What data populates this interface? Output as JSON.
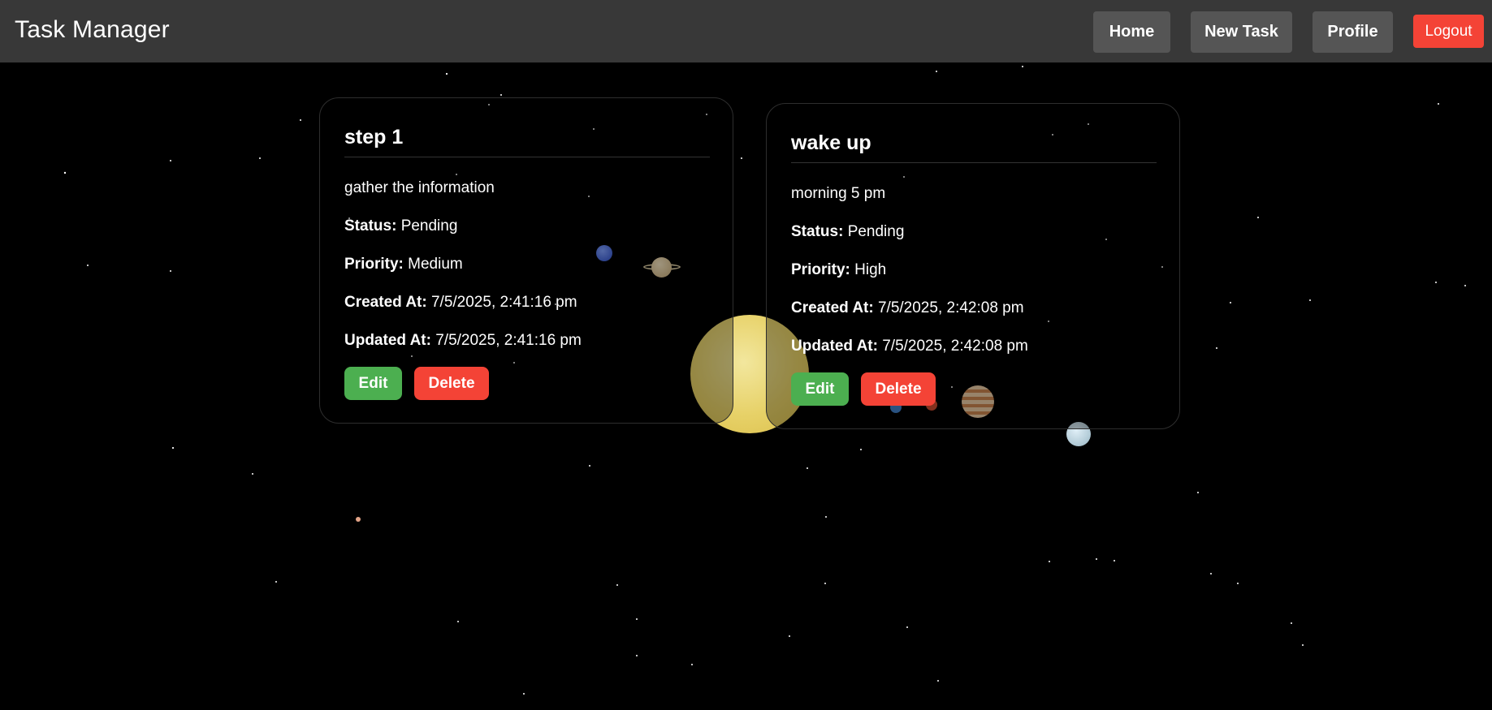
{
  "app": {
    "title": "Task Manager"
  },
  "nav": {
    "home_label": "Home",
    "new_task_label": "New Task",
    "profile_label": "Profile",
    "logout_label": "Logout"
  },
  "tasks": [
    {
      "title": "step 1",
      "description": "gather the information",
      "status_label": "Status:",
      "status": "Pending",
      "priority_label": "Priority:",
      "priority": "Medium",
      "created_label": "Created At:",
      "created_at": "7/5/2025, 2:41:16 pm",
      "updated_label": "Updated At:",
      "updated_at": "7/5/2025, 2:41:16 pm",
      "edit_label": "Edit",
      "delete_label": "Delete"
    },
    {
      "title": "wake up",
      "description": "morning 5 pm",
      "status_label": "Status:",
      "status": "Pending",
      "priority_label": "Priority:",
      "priority": "High",
      "created_label": "Created At:",
      "created_at": "7/5/2025, 2:42:08 pm",
      "updated_label": "Updated At:",
      "updated_at": "7/5/2025, 2:42:08 pm",
      "edit_label": "Edit",
      "delete_label": "Delete"
    }
  ],
  "colors": {
    "navbar": "#383838",
    "nav_button": "#555555",
    "logout": "#f44336",
    "edit": "#4caf50",
    "delete": "#f44336",
    "background": "#000000"
  },
  "background_decor": {
    "icons": [
      "starfield",
      "sun-icon",
      "neptune-icon",
      "saturn-icon",
      "jupiter-icon",
      "uranus-icon",
      "mars-icon",
      "earth-icon"
    ]
  }
}
